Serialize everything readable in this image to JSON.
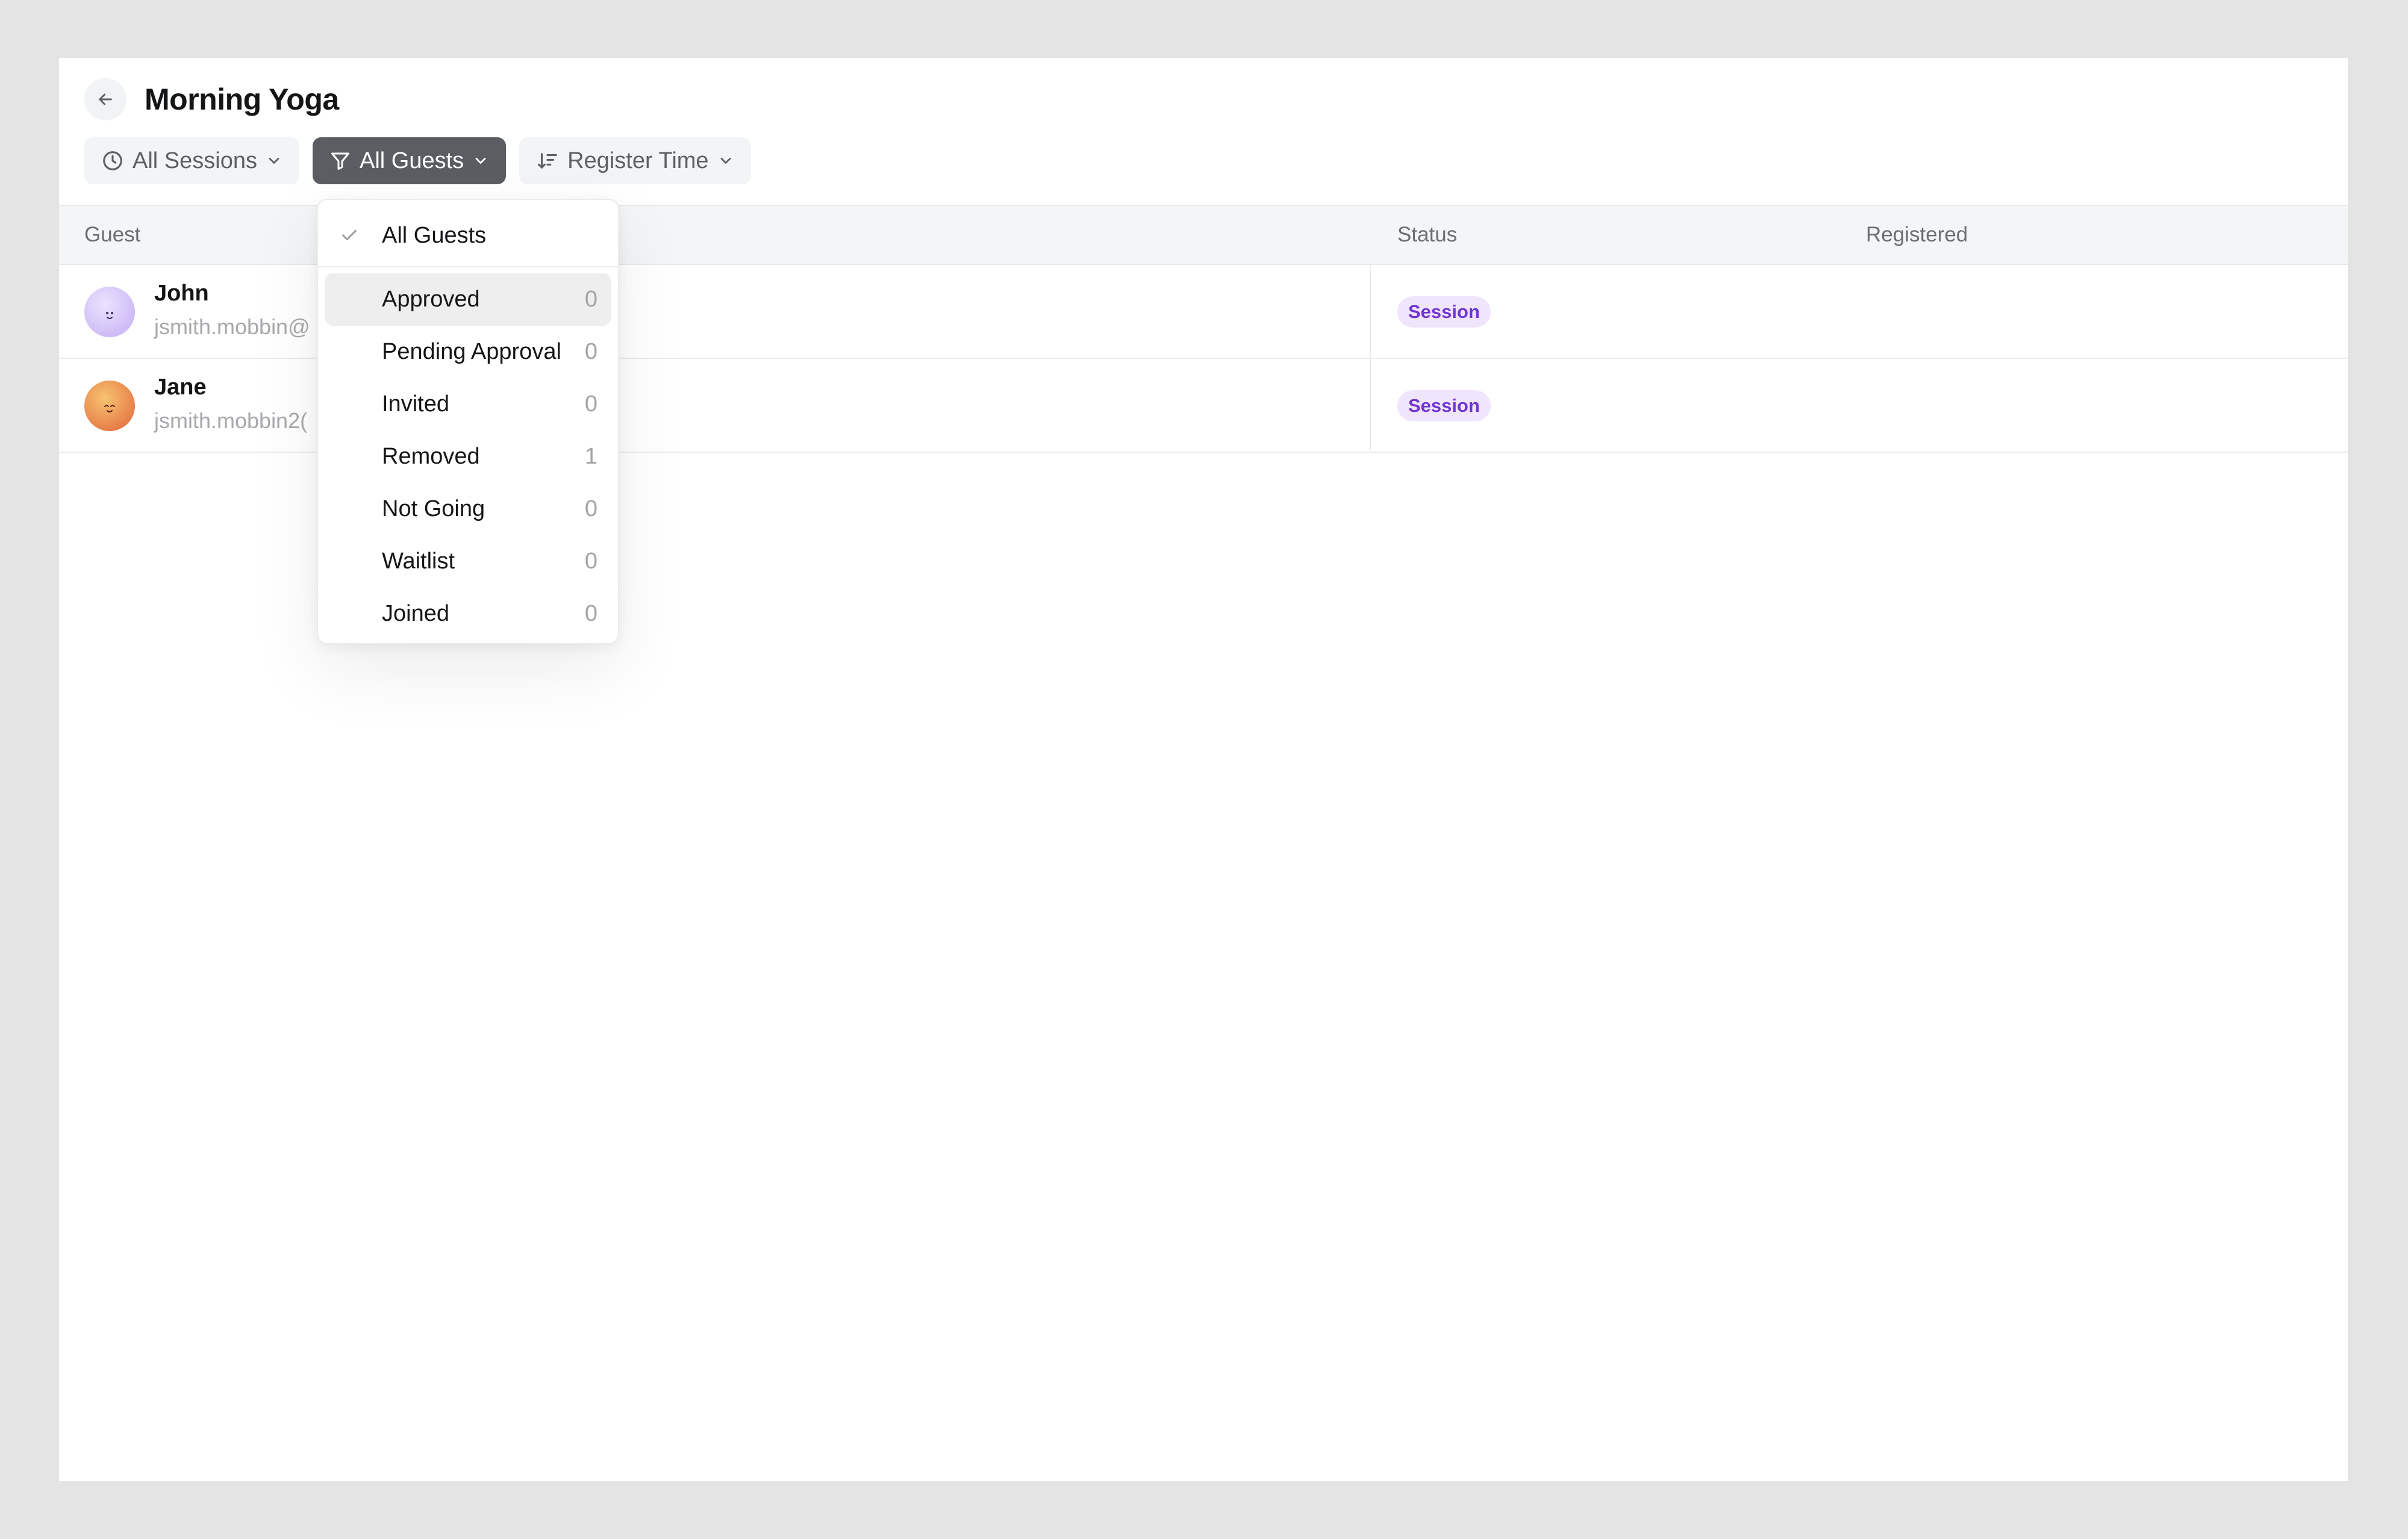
{
  "header": {
    "title": "Morning Yoga"
  },
  "toolbar": {
    "sessions_label": "All Sessions",
    "guests_label": "All Guests",
    "sort_label": "Register Time"
  },
  "table": {
    "columns": {
      "guest": "Guest",
      "status": "Status",
      "registered": "Registered"
    },
    "rows": [
      {
        "name": "John",
        "email": "jsmith.mobbin@",
        "status": "Session"
      },
      {
        "name": "Jane",
        "email": "jsmith.mobbin2(",
        "status": "Session"
      }
    ]
  },
  "dropdown": {
    "selected_label": "All Guests",
    "items": [
      {
        "label": "Approved",
        "count": "0"
      },
      {
        "label": "Pending Approval",
        "count": "0"
      },
      {
        "label": "Invited",
        "count": "0"
      },
      {
        "label": "Removed",
        "count": "1"
      },
      {
        "label": "Not Going",
        "count": "0"
      },
      {
        "label": "Waitlist",
        "count": "0"
      },
      {
        "label": "Joined",
        "count": "0"
      }
    ]
  },
  "icons": {
    "back": "arrow-left-icon",
    "sessions": "clock-icon",
    "guests": "filter-icon",
    "sort": "sort-icon",
    "chevron": "chevron-down-icon",
    "check": "check-icon"
  },
  "colors": {
    "active_filter_bg": "#5a5e63",
    "status_badge_bg": "#efe6fd",
    "status_badge_text": "#7235d1"
  }
}
